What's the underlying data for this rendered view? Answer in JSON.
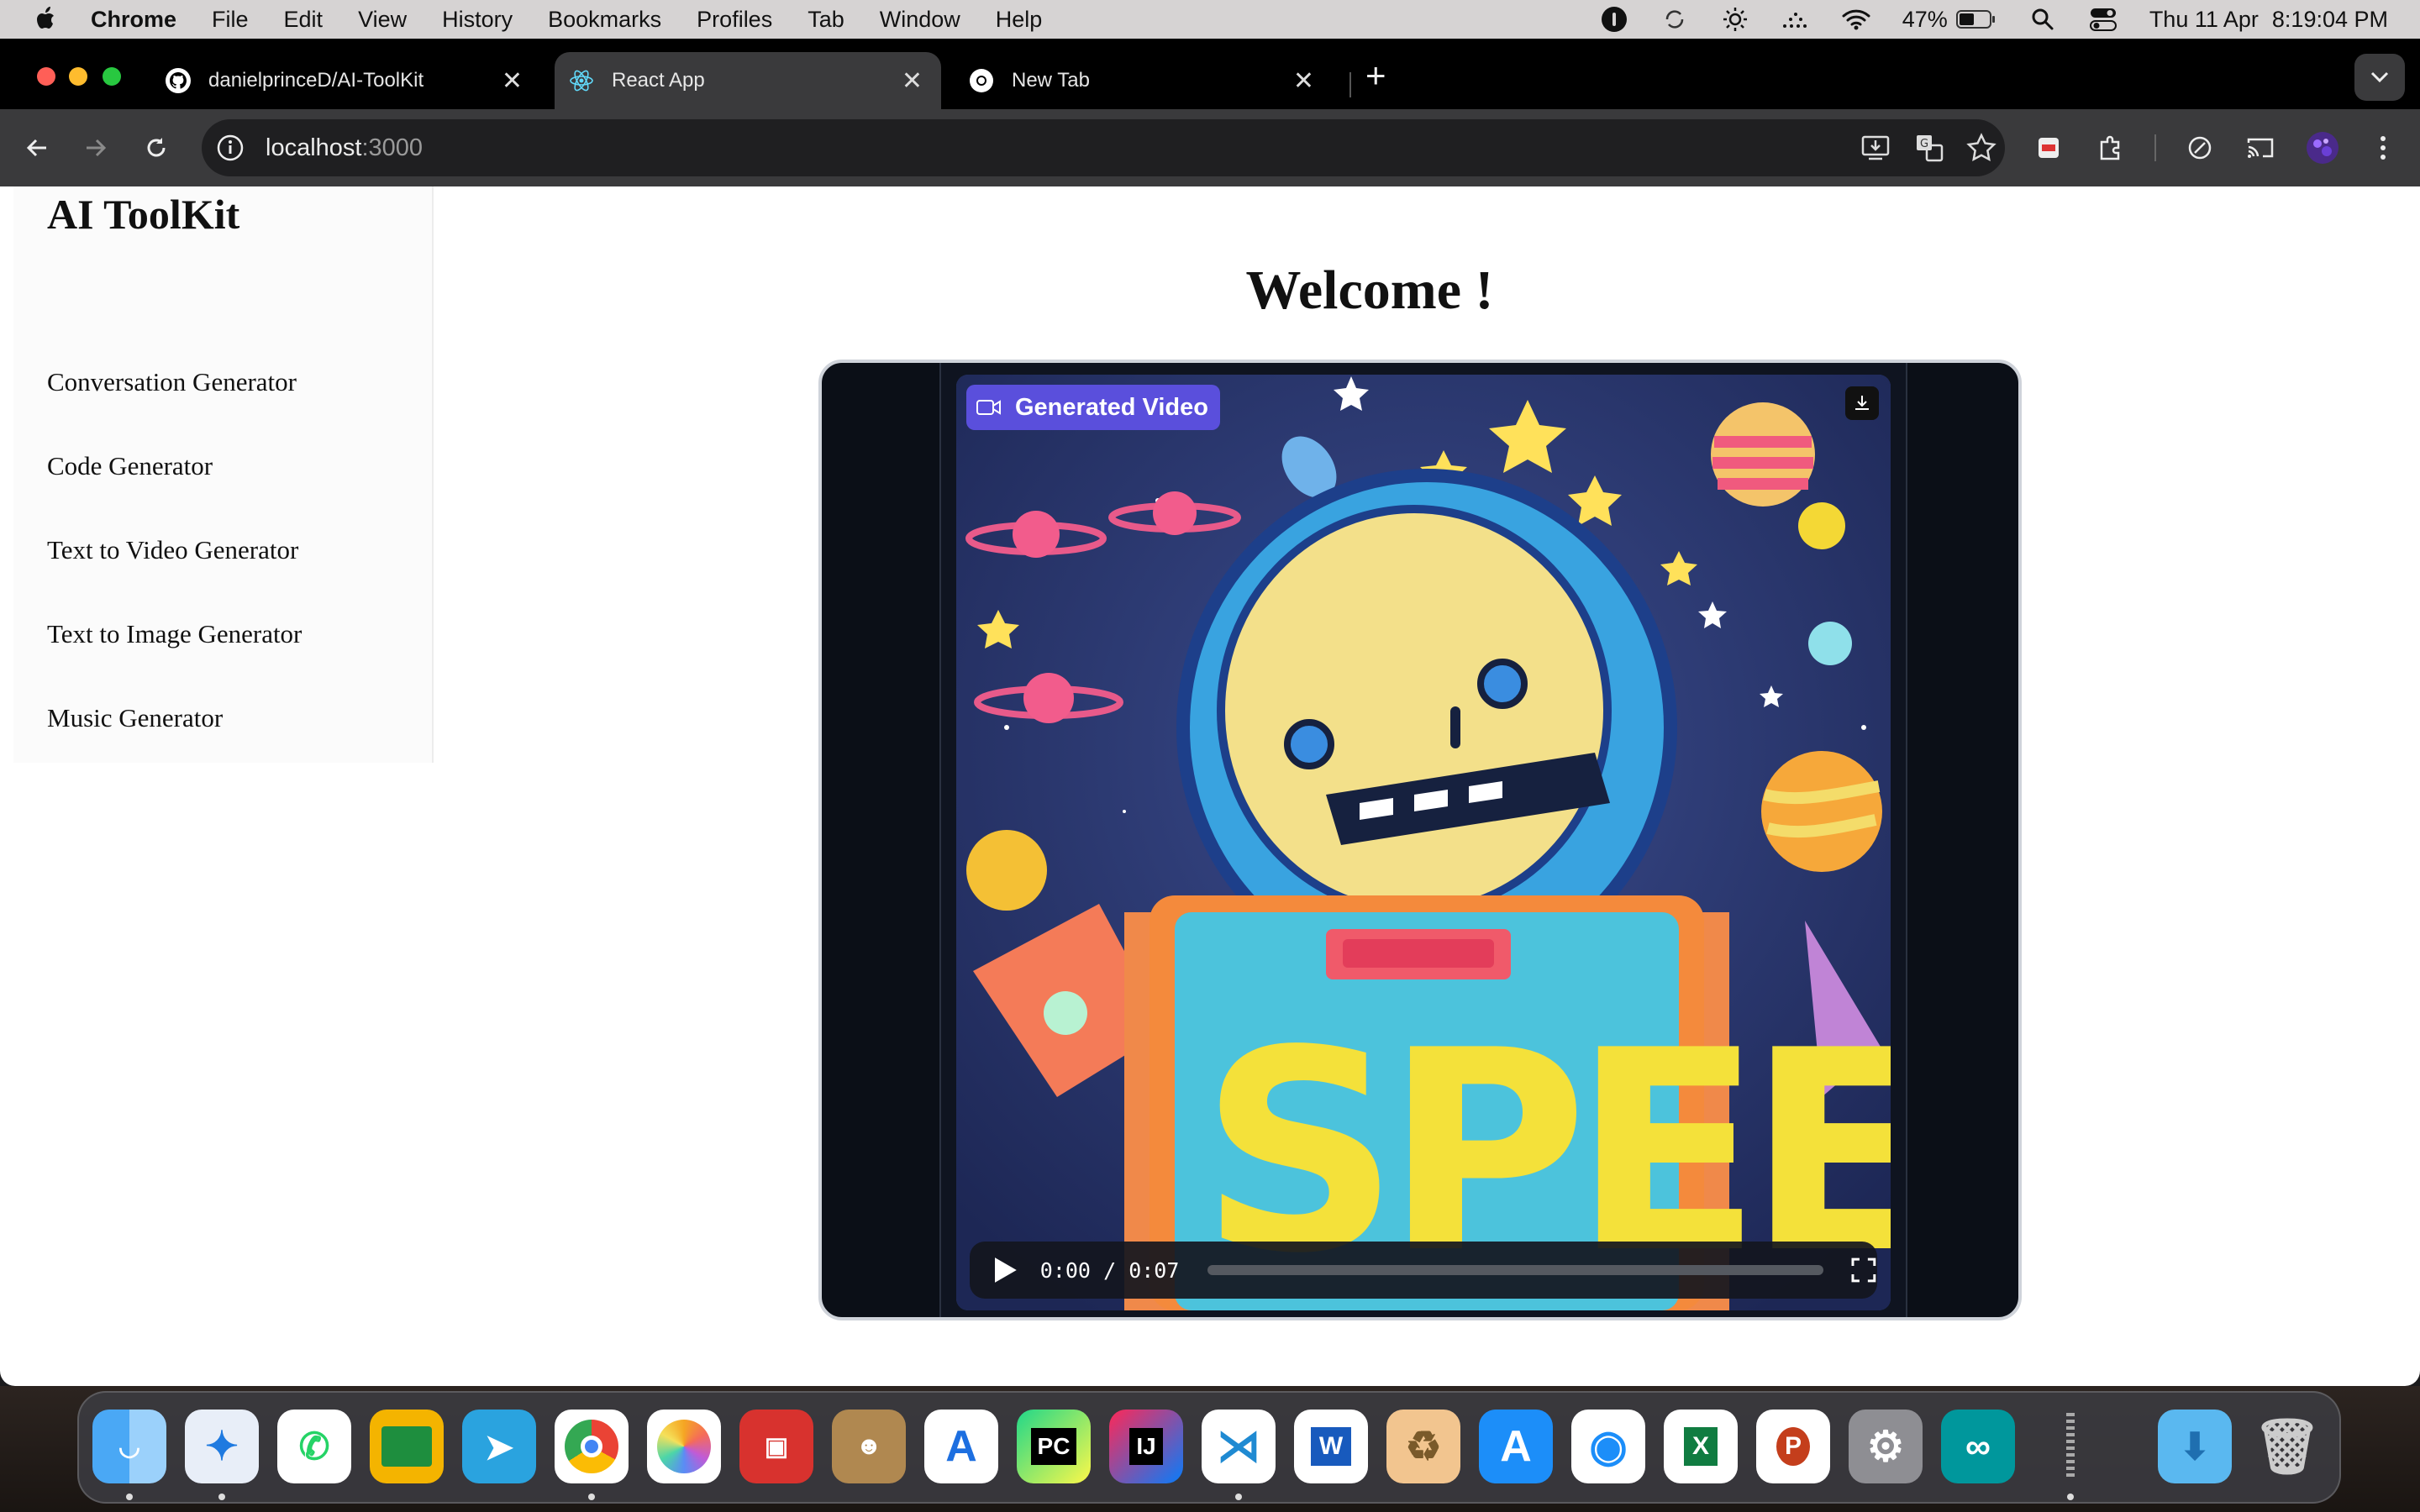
{
  "menubar": {
    "app_name": "Chrome",
    "menus": [
      "File",
      "Edit",
      "View",
      "History",
      "Bookmarks",
      "Profiles",
      "Tab",
      "Window",
      "Help"
    ],
    "battery": "47%",
    "date": "Thu 11 Apr",
    "time": "8:19:04 PM"
  },
  "browser": {
    "tabs": [
      {
        "title": "danielprinceD/AI-ToolKit",
        "icon": "github-icon",
        "active": false
      },
      {
        "title": "React App",
        "icon": "react-icon",
        "active": true
      },
      {
        "title": "New Tab",
        "icon": "chrome-icon",
        "active": false
      }
    ],
    "address": {
      "host": "localhost",
      "port": ":3000"
    }
  },
  "page": {
    "brand": "AI ToolKit",
    "nav_items": [
      "Conversation Generator",
      "Code Generator",
      "Text to Video Generator",
      "Text to Image Generator",
      "Music Generator"
    ],
    "welcome": "Welcome !",
    "video": {
      "label": "Generated Video",
      "current_time": "0:00",
      "separator": "/",
      "duration": "0:07",
      "progress": 0.0
    }
  },
  "dock": {
    "apps": [
      "Finder",
      "Safari",
      "WhatsApp",
      "Google Classroom",
      "Telegram",
      "Google Chrome",
      "Photos",
      "Photo Booth",
      "Contacts",
      "Instruments",
      "PyCharm",
      "IntelliJ IDEA",
      "Visual Studio Code",
      "Microsoft Word",
      "Recycle",
      "App Store",
      "AirDrop",
      "Microsoft Excel",
      "Microsoft PowerPoint",
      "System Settings",
      "Arduino IDE",
      "Audio",
      "Downloads",
      "Trash"
    ]
  },
  "colors": {
    "video_label_bg": "#5a4fdc",
    "player_bg": "#0b0f17",
    "tab_active_bg": "#3a3a3c"
  }
}
